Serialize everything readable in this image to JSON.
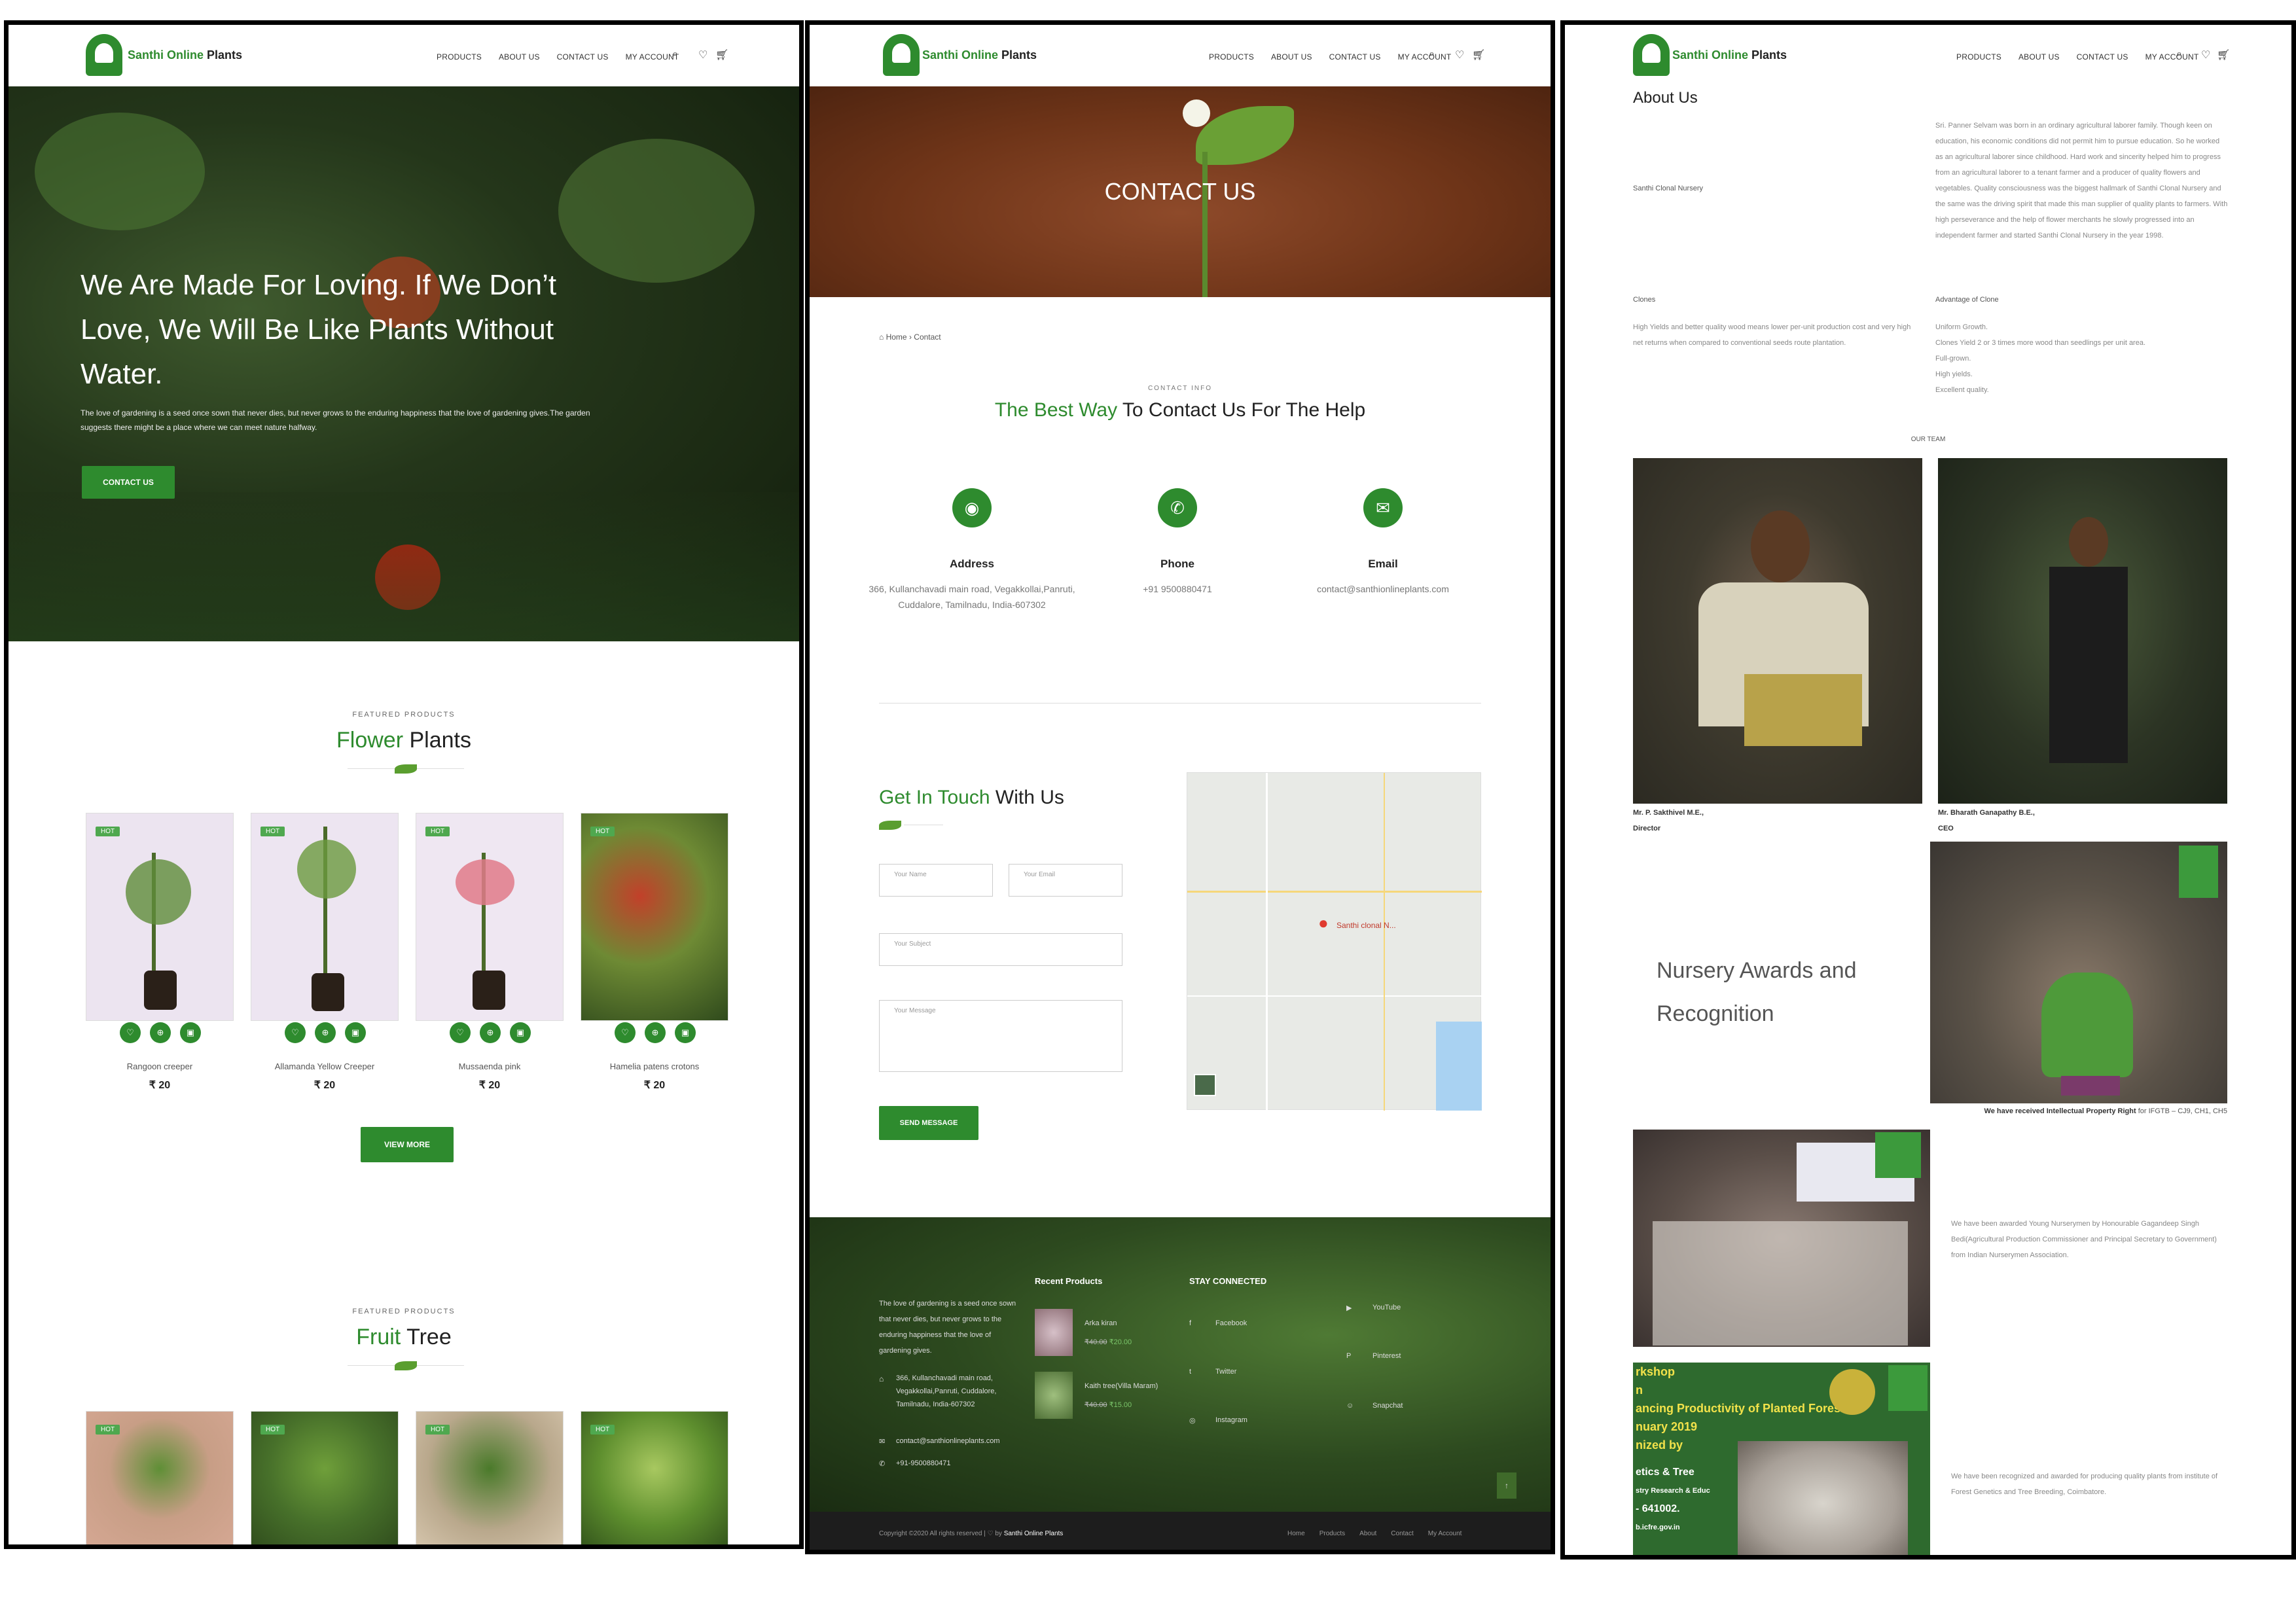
{
  "brand": {
    "name_green": "Santhi Online",
    "name_dark": "Plants"
  },
  "nav": {
    "products": "PRODUCTS",
    "about": "ABOUT US",
    "contact": "CONTACT US",
    "account": "MY ACCOUNT",
    "wishlist_count": "0",
    "cart_count": "0"
  },
  "home": {
    "hero_title": "We Are Made For Loving. If We Don’t Love, We Will Be Like Plants Without Water.",
    "hero_text": "The love of gardening is a seed once sown that never dies, but never grows to the enduring happiness that the love of gardening gives.The garden suggests there might be a place where we can meet nature halfway.",
    "hero_button": "CONTACT US",
    "featured_label": "FEATURED PRODUCTS",
    "flower_title_green": "Flower",
    "flower_title_dark": "Plants",
    "hot": "HOT",
    "products": [
      {
        "name": "Rangoon creeper",
        "price": "₹ 20"
      },
      {
        "name": "Allamanda Yellow Creeper",
        "price": "₹ 20"
      },
      {
        "name": "Mussaenda pink",
        "price": "₹ 20"
      },
      {
        "name": "Hamelia patens crotons",
        "price": "₹ 20"
      }
    ],
    "view_more": "VIEW MORE",
    "fruit_label": "FEATURED PRODUCTS",
    "fruit_title_green": "Fruit",
    "fruit_title_dark": "Tree"
  },
  "contact": {
    "banner": "CONTACT US",
    "breadcrumb_home": "Home",
    "breadcrumb_current": "Contact",
    "info_label": "CONTACT INFO",
    "title_green": "The Best Way",
    "title_dark": "To Contact Us For The Help",
    "address_title": "Address",
    "address_value": "366, Kullanchavadi main road, Vegakkollai,Panruti, Cuddalore, Tamilnadu, India-607302",
    "phone_title": "Phone",
    "phone_value": "+91 9500880471",
    "email_title": "Email",
    "email_value": "contact@santhionlineplants.com",
    "touch_green": "Get In Touch",
    "touch_dark": "With Us",
    "name_placeholder": "Your Name",
    "email_placeholder": "Your Email",
    "subject_placeholder": "Your Subject",
    "message_placeholder": "Your Message",
    "send": "SEND MESSAGE",
    "map_pin": "Santhi clonal N..."
  },
  "footer": {
    "about_text": "The love of gardening is a seed once sown that never dies, but never grows to the enduring happiness that the love of gardening gives.",
    "address": "366, Kullanchavadi main road, Vegakkollai,Panruti, Cuddalore, Tamilnadu, India-607302",
    "email": "contact@santhionlineplants.com",
    "phone": "+91-9500880471",
    "recent_title": "Recent Products",
    "recent": [
      {
        "name": "Arka kiran",
        "old": "₹40.00",
        "new": "₹20.00"
      },
      {
        "name": "Kaith tree(Villa Maram)",
        "old": "₹40.00",
        "new": "₹15.00"
      }
    ],
    "stay_title": "STAY CONNECTED",
    "social": [
      "Facebook",
      "Twitter",
      "Instagram",
      "YouTube",
      "Pinterest",
      "Snapchat"
    ],
    "copyright_pre": "Copyright ©2020 All rights reserved | ♡ by",
    "copyright_brand": "Santhi Online Plants",
    "links": [
      "Home",
      "Products",
      "About",
      "Contact",
      "My Account"
    ]
  },
  "about": {
    "title": "About Us",
    "nursery_label": "Santhi Clonal Nursery",
    "story": "Sri. Panner Selvam was born in an ordinary agricultural laborer family. Though keen on education, his economic conditions did not permit him to pursue education. So he worked as an agricultural laborer since childhood. Hard work and sincerity helped him to progress from an agricultural laborer to a tenant farmer and a producer of quality flowers and vegetables. Quality consciousness was the biggest hallmark of Santhi Clonal Nursery and the same was the driving spirit that made this man supplier of quality plants to farmers. With high perseverance and the help of flower merchants he slowly progressed into an independent farmer and started Santhi Clonal Nursery in the year 1998.",
    "clones_title": "Clones",
    "clones_text": "High Yields and better quality wood means lower per-unit production cost and very high net returns when compared to conventional seeds route plantation.",
    "adv_title": "Advantage of Clone",
    "adv_items": [
      "Uniform Growth.",
      "Clones Yield 2 or 3 times more wood than seedlings per unit area.",
      "Full-grown.",
      "High yields.",
      "Excellent quality."
    ],
    "team_label": "OUR TEAM",
    "team": [
      {
        "name": "Mr. P. Sakthivel M.E.,",
        "role": "Director"
      },
      {
        "name": "Mr. Bharath Ganapathy B.E.,",
        "role": "CEO"
      }
    ],
    "awards_title_1": "Nursery Awards and",
    "awards_title_2": "Recognition",
    "ipr_pre": "We have received Intellectual Property Right",
    "ipr_post": "for IFGTB – CJ9, CH1, CH5",
    "award1": "We have been awarded Young Nurserymen by Honourable Gagandeep Singh Bedi(Agricultural Production Commissioner and Principal Secretary to Government) from Indian Nurserymen Association.",
    "award2": "We have been recognized and awarded for producing quality plants from institute of Forest Genetics and Tree Breeding, Coimbatore.",
    "photo_banner": "Santhi Clonal Nursery",
    "photo_text_lines": [
      "rkshop",
      "n",
      "ancing Productivity of Planted Forests\"",
      "nuary 2019",
      "nized by",
      "etics & Tree",
      "stry Research & Educ",
      "- 641002.",
      "b.icfre.gov.in"
    ]
  },
  "colors": {
    "accent": "#2e8b2e",
    "dark_footer": "#1d1d1d"
  }
}
